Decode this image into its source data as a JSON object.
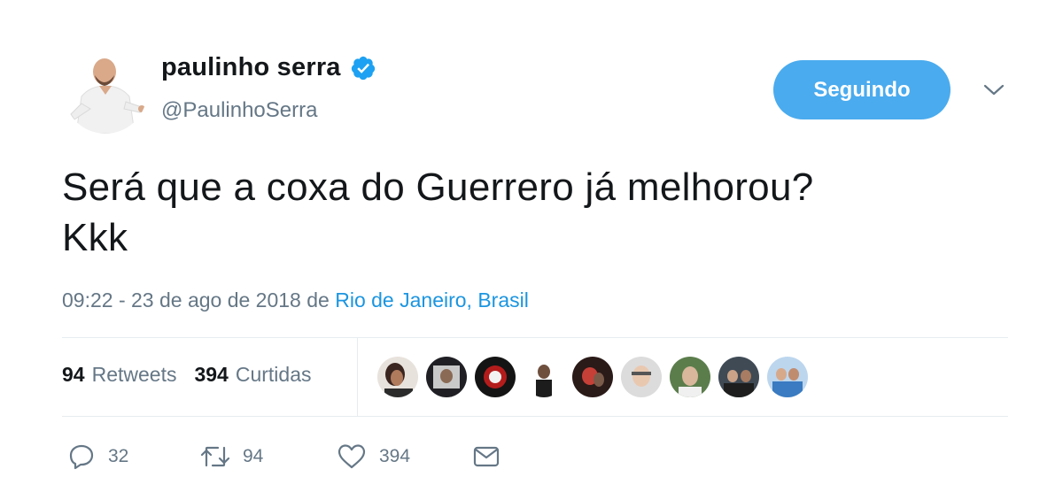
{
  "tweet": {
    "display_name": "paulinho serra",
    "handle": "@PaulinhoSerra",
    "follow_button_label": "Seguindo",
    "text": "Será que a coxa do Guerrero já melhorou?\nKkk",
    "meta": {
      "timestamp": "09:22 - 23 de ago de 2018",
      "from_word": "de",
      "location": "Rio de Janeiro, Brasil"
    },
    "stats": {
      "retweets_count": "94",
      "retweets_label": "Retweets",
      "likes_count": "394",
      "likes_label": "Curtidas"
    },
    "actions": {
      "reply_count": "32",
      "retweet_count": "94",
      "like_count": "394"
    },
    "icons": {
      "verified": "verified-badge-icon",
      "caret": "chevron-down-icon",
      "reply": "reply-icon",
      "retweet": "retweet-icon",
      "like": "heart-icon",
      "message": "envelope-icon"
    },
    "colors": {
      "accent": "#1b95e0",
      "button_bg": "#4aabee",
      "secondary_text": "#657786",
      "primary_text": "#14171a",
      "divider": "#e6ecf0"
    },
    "likers_count_shown": 9
  }
}
